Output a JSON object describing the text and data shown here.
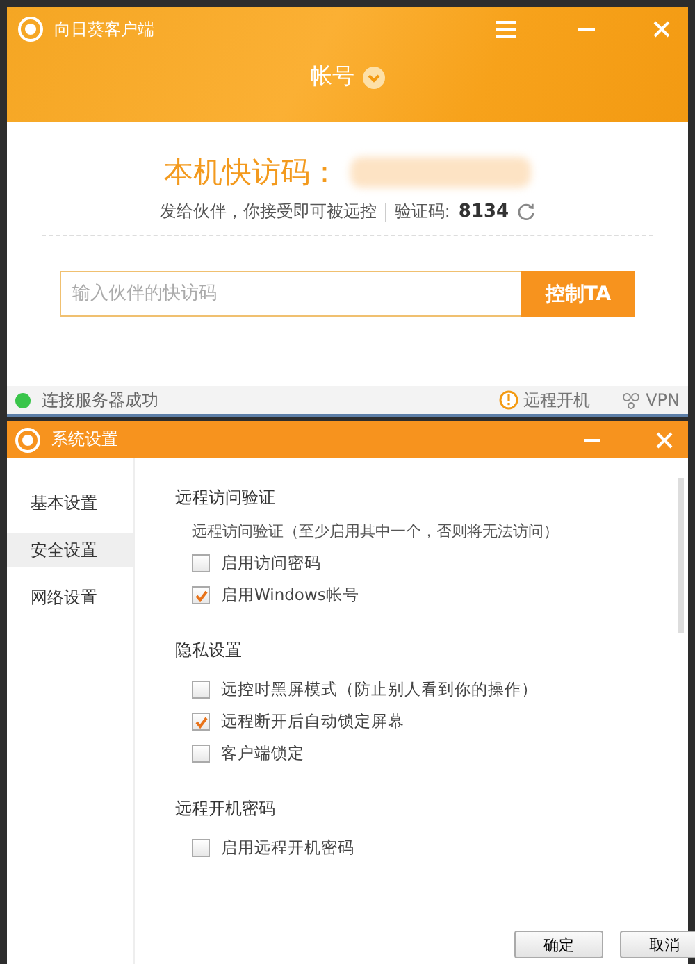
{
  "main_window": {
    "title": "向日葵客户端",
    "account": "帐号",
    "quick_code_label": "本机快访码：",
    "hint": "发给伙伴，你接受即可被远控",
    "verify_label": "验证码:",
    "verify_code": "8134",
    "partner_field": {
      "placeholder": "输入伙伴的快访码"
    },
    "control_button": "控制TA"
  },
  "status_bar": {
    "connected": true,
    "message": "连接服务器成功",
    "items": [
      {
        "kind": "power",
        "label": "远程开机"
      },
      {
        "kind": "vpn",
        "label": "VPN"
      }
    ]
  },
  "settings_window": {
    "title": "系统设置",
    "sidebar": [
      {
        "label": "基本设置",
        "selected": false
      },
      {
        "label": "安全设置",
        "selected": true
      },
      {
        "label": "网络设置",
        "selected": false
      }
    ],
    "sections": [
      {
        "title": "远程访问验证",
        "note": "远程访问验证（至少启用其中一个，否则将无法访问）",
        "options": [
          {
            "label": "启用访问密码",
            "checked": false
          },
          {
            "label": "启用Windows帐号",
            "checked": true
          }
        ]
      },
      {
        "title": "隐私设置",
        "options": [
          {
            "label": "远控时黑屏模式（防止别人看到你的操作）",
            "checked": false
          },
          {
            "label": "远程断开后自动锁定屏幕",
            "checked": true
          },
          {
            "label": "客户端锁定",
            "checked": false
          }
        ]
      },
      {
        "title": "远程开机密码",
        "options": [
          {
            "label": "启用远程开机密码",
            "checked": false
          }
        ]
      }
    ],
    "buttons": [
      "确定",
      "取消"
    ]
  }
}
